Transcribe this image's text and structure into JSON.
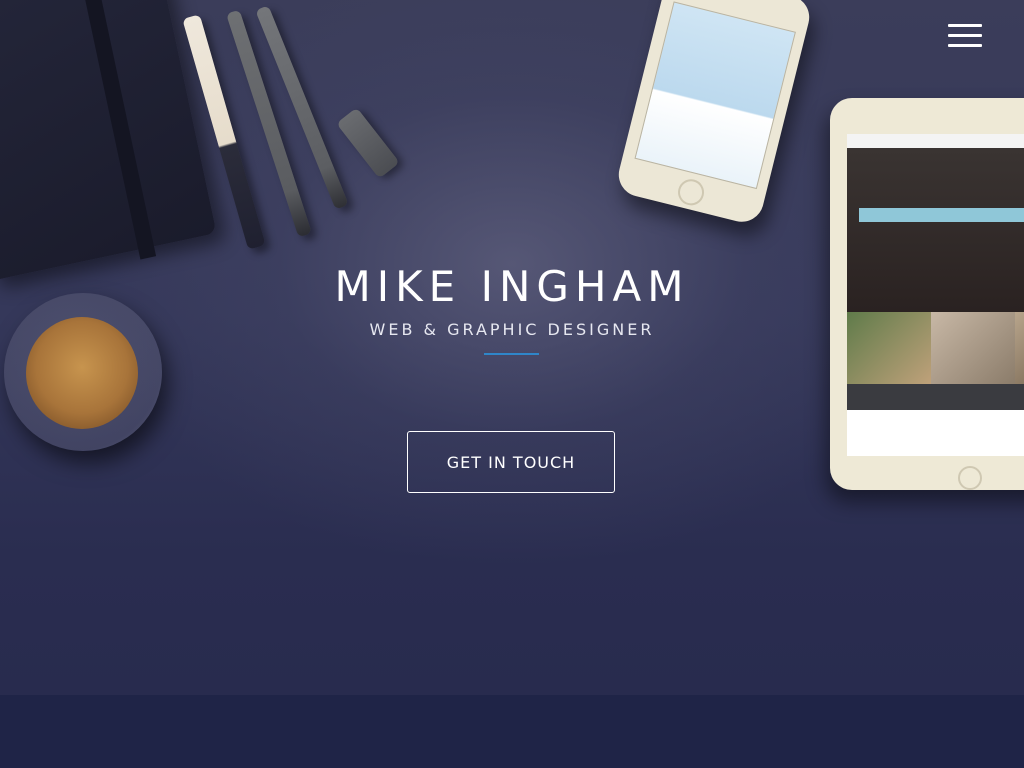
{
  "header": {
    "menu_icon": "hamburger-menu-icon"
  },
  "hero": {
    "title": "MIKE INGHAM",
    "subtitle": "WEB & GRAPHIC DESIGNER",
    "cta_label": "GET IN TOUCH"
  },
  "colors": {
    "background": "#2b2e52",
    "footer_band": "#1f2447",
    "accent": "#2f86c9",
    "text": "#ffffff"
  }
}
